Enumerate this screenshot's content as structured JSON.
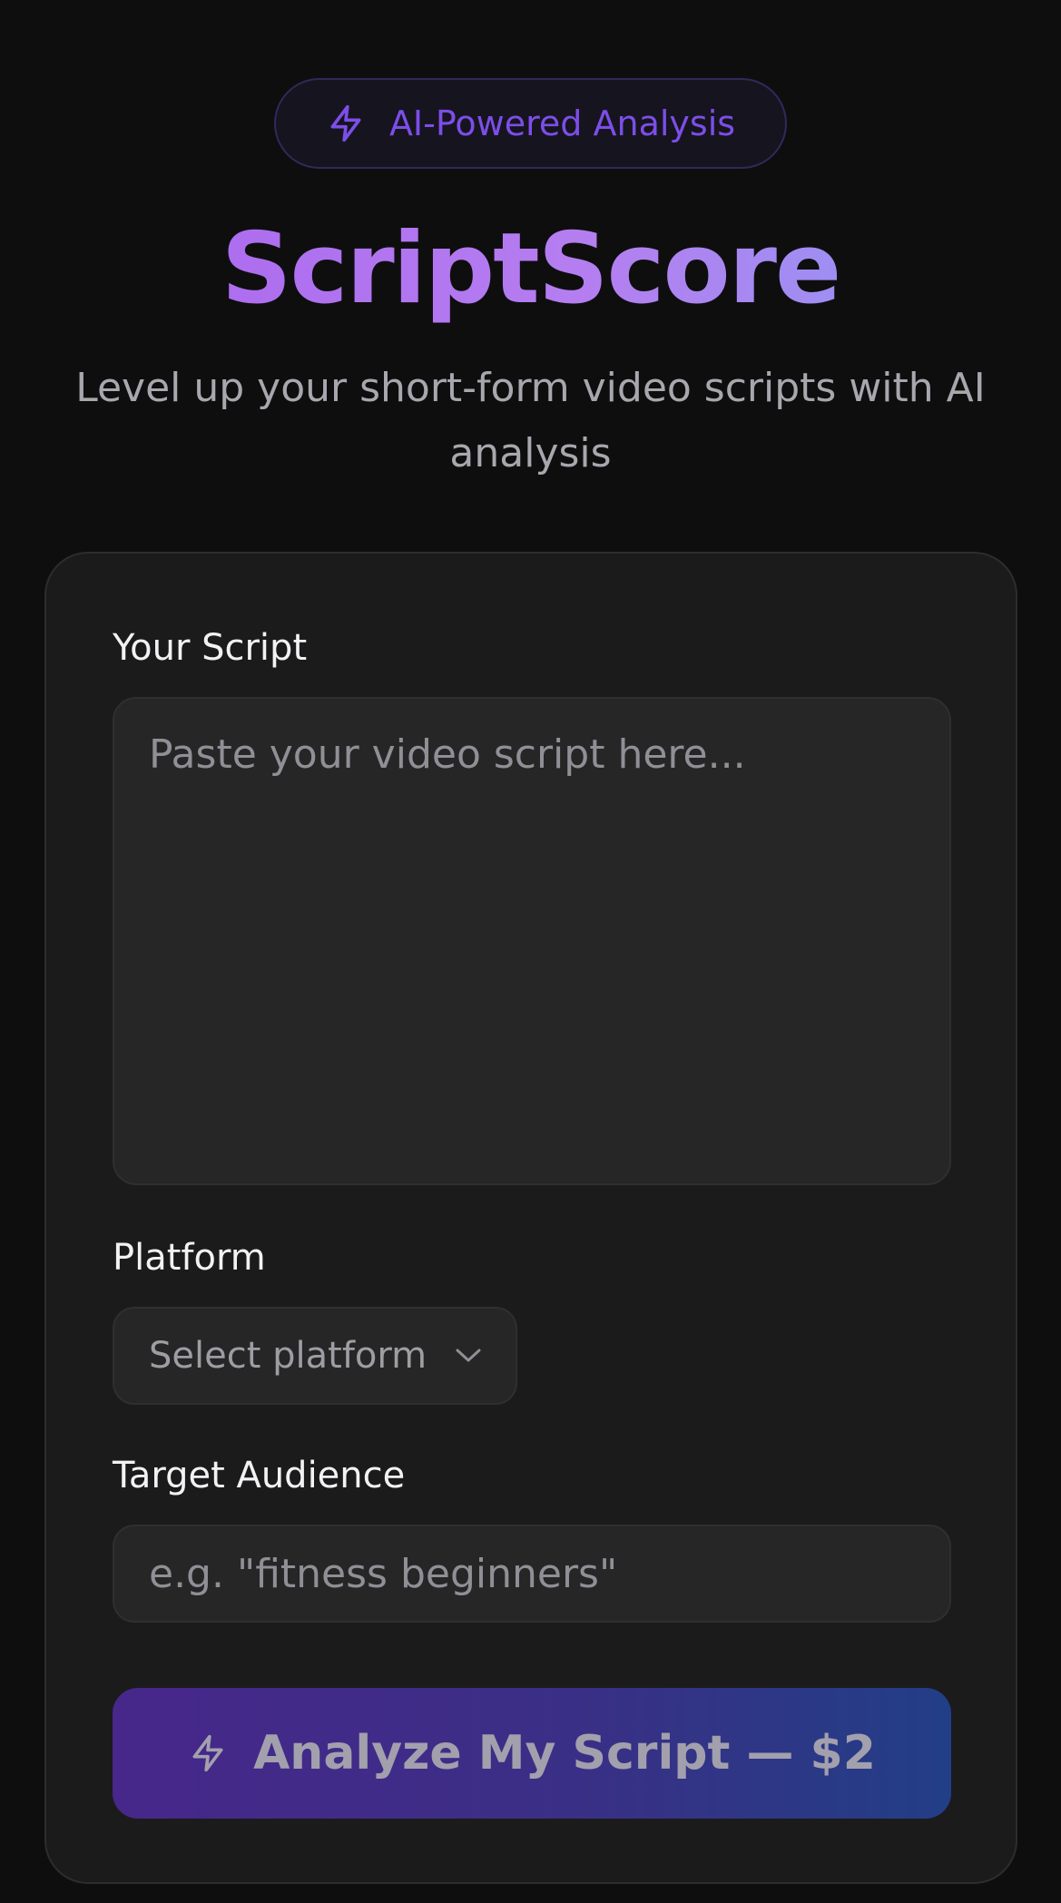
{
  "badge": {
    "label": "AI-Powered Analysis",
    "icon": "lightning-bolt-icon",
    "color": "#7c4ee8"
  },
  "header": {
    "title": "ScriptScore",
    "subtitle": "Level up your short-form video scripts with AI analysis"
  },
  "form": {
    "script": {
      "label": "Your Script",
      "placeholder": "Paste your video script here..."
    },
    "platform": {
      "label": "Platform",
      "placeholder": "Select platform",
      "icon": "chevron-down-icon"
    },
    "audience": {
      "label": "Target Audience",
      "placeholder": "e.g. \"fitness beginners\""
    },
    "submit": {
      "label": "Analyze My Script — $2",
      "icon": "lightning-bolt-icon"
    }
  },
  "colors": {
    "background": "#0e0e0f",
    "card": "#1b1b1c",
    "accent_purple": "#a863ee",
    "accent_blue": "#8b9df3"
  }
}
